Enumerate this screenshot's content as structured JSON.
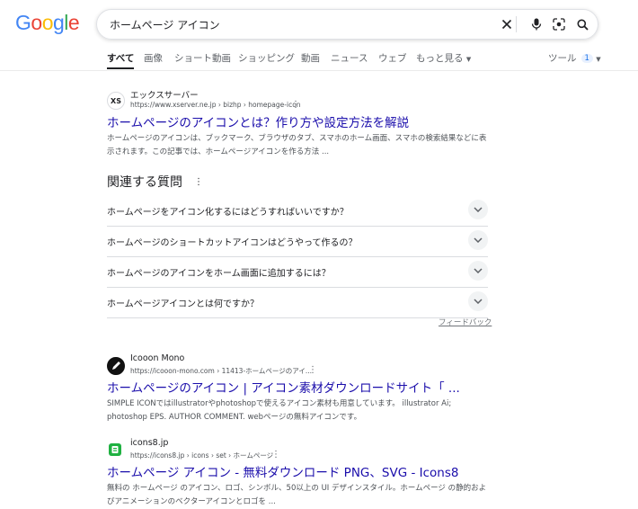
{
  "logo": {
    "letters": [
      "G",
      "o",
      "o",
      "g",
      "l",
      "e"
    ],
    "colors": [
      "#4285f4",
      "#ea4335",
      "#fbbc05",
      "#4285f4",
      "#34a853",
      "#ea4335"
    ]
  },
  "search": {
    "query": "ホームページ アイコン",
    "icons": [
      "close-icon",
      "mic-icon",
      "lens-icon",
      "search-icon"
    ]
  },
  "tabs": [
    "すべて",
    "画像",
    "ショート動画",
    "ショッピング",
    "動画",
    "ニュース",
    "ウェブ",
    "もっと見る"
  ],
  "tools": {
    "label": "ツール",
    "badge": "1"
  },
  "results": [
    {
      "favicon_text": "XS",
      "site": "エックスサーバー",
      "url": "https://www.xserver.ne.jp › bizhp › homepage-icon",
      "title": "ホームページのアイコンとは？作り方や設定方法を解説",
      "snippet": "ホームページのアイコンは、ブックマーク、ブラウザのタブ、スマホのホーム画面、スマホの検索結果などに表示されます。この記事では、ホームページアイコンを作る方法 ..."
    },
    {
      "favicon_text": "",
      "site": "Icooon Mono",
      "url": "https://icooon-mono.com › 11413-ホームページのアイ...",
      "title": "ホームページのアイコン | アイコン素材ダウンロードサイト「 ...",
      "snippet": "SIMPLE ICONではillustratorやphotoshopで使えるアイコン素材も用意しています。 illustrator Ai; photoshop EPS. AUTHOR COMMENT. webページの無料アイコンです。"
    },
    {
      "favicon_text": "",
      "site": "icons8.jp",
      "url": "https://icons8.jp › icons › set › ホームページ",
      "title": "ホームページ アイコン - 無料ダウンロード PNG、SVG - Icons8",
      "snippet": "無料の ホームページ のアイコン、ロゴ、シンボル、50以上の UI デザインスタイル。ホームページ の静的およびアニメーションのベクターアイコンとロゴを ..."
    }
  ],
  "paa": {
    "heading": "関連する質問",
    "questions": [
      "ホームページをアイコン化するにはどうすればいいですか？",
      "ホームページのショートカットアイコンはどうやって作るの？",
      "ホームページのアイコンをホーム画面に追加するには？",
      "ホームページアイコンとは何ですか？"
    ],
    "feedback": "フィードバック"
  }
}
